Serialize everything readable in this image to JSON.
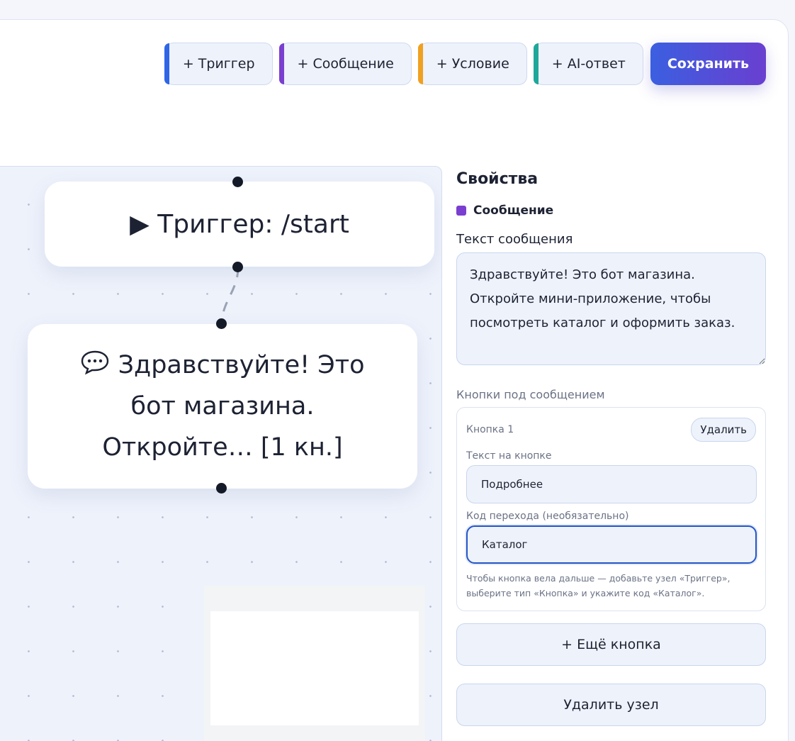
{
  "toolbar": {
    "add_trigger": "+ Триггер",
    "add_message": "+ Сообщение",
    "add_condition": "+ Условие",
    "add_ai": "+ AI-ответ",
    "save": "Сохранить"
  },
  "colors": {
    "trigger": "#2f66e8",
    "message": "#7a3fd0",
    "condition": "#f0a020",
    "ai": "#1fa89a"
  },
  "canvas": {
    "nodes": [
      {
        "type": "trigger",
        "icon": "play-icon",
        "icon_glyph": "▶",
        "text": "Триггер: /start"
      },
      {
        "type": "message",
        "icon": "speech-bubble-icon",
        "text": "Здравствуйте! Это бот магазина. Откройте… [1 кн.]"
      }
    ]
  },
  "properties": {
    "title": "Свойства",
    "node_type": "Сообщение",
    "text_label": "Текст сообщения",
    "text_value": "Здравствуйте! Это бот магазина. Откройте мини-приложение, чтобы посмотреть каталог и оформить заказ.",
    "buttons_label": "Кнопки под сообщением",
    "button": {
      "title": "Кнопка 1",
      "delete": "Удалить",
      "text_label": "Текст на кнопке",
      "text_value": "Подробнее",
      "code_label": "Код перехода (необязательно)",
      "code_value": "Каталог",
      "hint": "Чтобы кнопка вела дальше — добавьте узел «Триггер», выберите тип «Кнопка» и укажите код «Каталог»."
    },
    "add_button": "+ Ещё кнопка",
    "delete_node": "Удалить узел"
  }
}
